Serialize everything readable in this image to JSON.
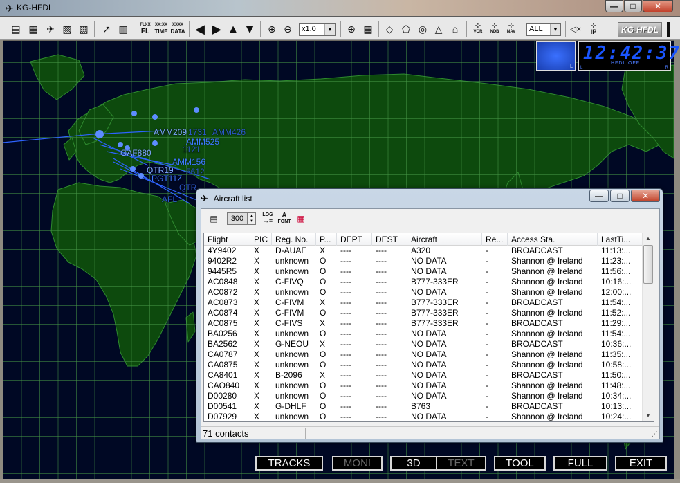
{
  "window": {
    "title": "KG-HFDL",
    "app_icon": "plane-icon",
    "controls": {
      "minimize": "—",
      "maximize": "□",
      "close": "✕"
    }
  },
  "toolbar": {
    "buttons": [
      {
        "name": "list-icon",
        "glyph": "▤"
      },
      {
        "name": "doc-list-icon",
        "glyph": "▦"
      },
      {
        "name": "plane-settings-icon",
        "glyph": "✈"
      },
      {
        "name": "doc-edit-icon",
        "glyph": "▧"
      },
      {
        "name": "doc-icon",
        "glyph": "▨"
      },
      {
        "name": "route-icon",
        "glyph": "↗"
      },
      {
        "name": "radio-icon",
        "glyph": "▥"
      }
    ],
    "filters": {
      "fl": "FL",
      "fl_top": "FLXX",
      "time": "TIME",
      "time_top": "XX:XX",
      "data": "DATA",
      "data_top": "XXXX"
    },
    "nav": [
      "◀",
      "▶",
      "▲",
      "▼"
    ],
    "zoom_in": "⊕",
    "zoom_out": "⊖",
    "zoom_value": "x1.0",
    "globe": "⊕",
    "grid": "▦",
    "shapes": [
      "◇",
      "⬠",
      "◎",
      "△",
      "⌂"
    ],
    "vor_label": "VOR",
    "ndb_label": "NDB",
    "nav_label": "NAV",
    "filter_value": "ALL",
    "mute": "◁×",
    "ip_label": "IP",
    "brand": "KG-HFDL"
  },
  "clock": {
    "time": "12:42:37",
    "sub": "HFDL OFF",
    "meter_left": "L",
    "meter_right": "R",
    "spectrum_label": "L"
  },
  "map_labels": [
    {
      "text": "AMM209",
      "cls": "bright"
    },
    {
      "text": "1731",
      "cls": "dim"
    },
    {
      "text": "AMM426",
      "cls": "dim"
    },
    {
      "text": "AMM525",
      "cls": ""
    },
    {
      "text": "GAF880",
      "cls": "bright"
    },
    {
      "text": "1121",
      "cls": "dim"
    },
    {
      "text": "AMM156",
      "cls": ""
    },
    {
      "text": "QTR19",
      "cls": "bright"
    },
    {
      "text": "5612",
      "cls": "dim"
    },
    {
      "text": "PGT11Z",
      "cls": ""
    },
    {
      "text": "QTR",
      "cls": "dim"
    },
    {
      "text": "AFL",
      "cls": "dim"
    }
  ],
  "bottom_buttons": [
    {
      "label": "TRACKS",
      "enabled": true
    },
    {
      "label": "MONI",
      "enabled": false
    },
    {
      "label": "3D",
      "enabled": true
    },
    {
      "label": "TEXT",
      "enabled": false
    },
    {
      "label": "TOOL",
      "enabled": true
    },
    {
      "label": "FULL",
      "enabled": true
    },
    {
      "label": "EXIT",
      "enabled": true
    }
  ],
  "aircraft_list": {
    "title": "Aircraft list",
    "interval_value": "300",
    "log_label": "LOG",
    "font_label": "FONT",
    "columns": [
      "Flight",
      "PIC",
      "Reg. No.",
      "P...",
      "DEPT",
      "DEST",
      "Aircraft",
      "Re...",
      "Access Sta.",
      "LastTi..."
    ],
    "rows": [
      [
        "4Y9402",
        "X",
        "D-AUAE",
        "X",
        "----",
        "----",
        "A320",
        "-",
        "BROADCAST",
        "11:13:..."
      ],
      [
        "9402R2",
        "X",
        "unknown",
        "O",
        "----",
        "----",
        "NO DATA",
        "-",
        "Shannon @ Ireland",
        "11:23:..."
      ],
      [
        "9445R5",
        "X",
        "unknown",
        "O",
        "----",
        "----",
        "NO DATA",
        "-",
        "Shannon @ Ireland",
        "11:56:..."
      ],
      [
        "AC0848",
        "X",
        "C-FIVQ",
        "O",
        "----",
        "----",
        "B777-333ER",
        "-",
        "Shannon @ Ireland",
        "10:16:..."
      ],
      [
        "AC0872",
        "X",
        "unknown",
        "O",
        "----",
        "----",
        "NO DATA",
        "-",
        "Shannon @ Ireland",
        "12:00:..."
      ],
      [
        "AC0873",
        "X",
        "C-FIVM",
        "X",
        "----",
        "----",
        "B777-333ER",
        "-",
        "BROADCAST",
        "11:54:..."
      ],
      [
        "AC0874",
        "X",
        "C-FIVM",
        "O",
        "----",
        "----",
        "B777-333ER",
        "-",
        "Shannon @ Ireland",
        "11:52:..."
      ],
      [
        "AC0875",
        "X",
        "C-FIVS",
        "X",
        "----",
        "----",
        "B777-333ER",
        "-",
        "BROADCAST",
        "11:29:..."
      ],
      [
        "BA0256",
        "X",
        "unknown",
        "O",
        "----",
        "----",
        "NO DATA",
        "-",
        "Shannon @ Ireland",
        "11:54:..."
      ],
      [
        "BA2562",
        "X",
        "G-NEOU",
        "X",
        "----",
        "----",
        "NO DATA",
        "-",
        "BROADCAST",
        "10:36:..."
      ],
      [
        "CA0787",
        "X",
        "unknown",
        "O",
        "----",
        "----",
        "NO DATA",
        "-",
        "Shannon @ Ireland",
        "11:35:..."
      ],
      [
        "CA0875",
        "X",
        "unknown",
        "O",
        "----",
        "----",
        "NO DATA",
        "-",
        "Shannon @ Ireland",
        "10:58:..."
      ],
      [
        "CA8401",
        "X",
        "B-2096",
        "X",
        "----",
        "----",
        "NO DATA",
        "-",
        "BROADCAST",
        "11:50:..."
      ],
      [
        "CAO840",
        "X",
        "unknown",
        "O",
        "----",
        "----",
        "NO DATA",
        "-",
        "Shannon @ Ireland",
        "11:48:..."
      ],
      [
        "D00280",
        "X",
        "unknown",
        "O",
        "----",
        "----",
        "NO DATA",
        "-",
        "Shannon @ Ireland",
        "10:34:..."
      ],
      [
        "D00541",
        "X",
        "G-DHLF",
        "O",
        "----",
        "----",
        "B763",
        "-",
        "BROADCAST",
        "10:13:..."
      ],
      [
        "D07929",
        "X",
        "unknown",
        "O",
        "----",
        "----",
        "NO DATA",
        "-",
        "Shannon @ Ireland",
        "10:24:..."
      ]
    ],
    "status": "71 contacts"
  }
}
